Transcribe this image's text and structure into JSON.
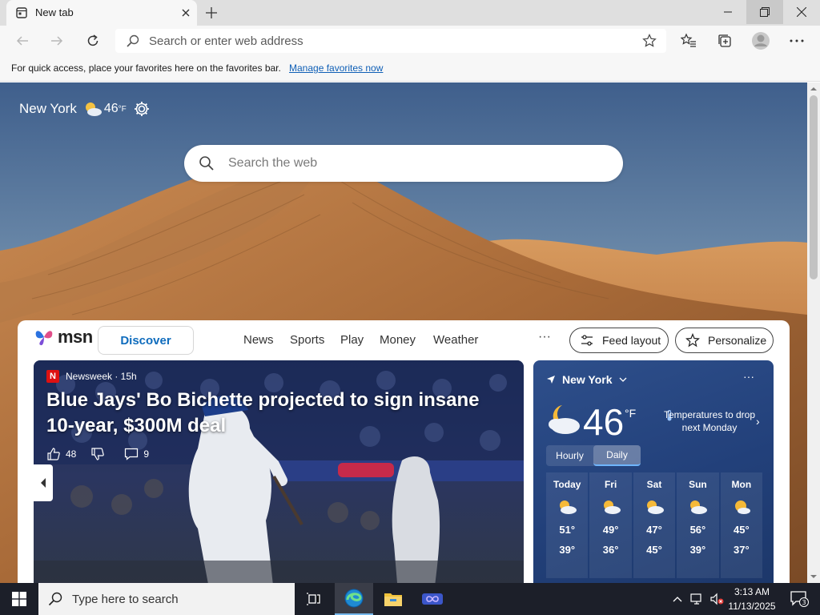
{
  "browser": {
    "tab_title": "New tab",
    "address_placeholder": "Search or enter web address",
    "favbar_text": "For quick access, place your favorites here on the favorites bar.",
    "favbar_link": "Manage favorites now"
  },
  "newtab": {
    "weather_city": "New York",
    "weather_temp": "46",
    "weather_unit": "°F",
    "search_placeholder": "Search the web"
  },
  "feed": {
    "logo": "msn",
    "nav": [
      "Discover",
      "News",
      "Sports",
      "Play",
      "Money",
      "Weather"
    ],
    "more": "···",
    "feed_layout": "Feed layout",
    "personalize": "Personalize"
  },
  "hero": {
    "source_badge": "N",
    "source": "Newsweek · 15h",
    "title": "Blue Jays' Bo Bichette projected to sign insane 10-year, $300M deal",
    "likes": "48",
    "comments": "9"
  },
  "weather_card": {
    "location": "New York",
    "more": "···",
    "temp": "46",
    "unit": "°F",
    "alert": "Temperatures to drop next Monday",
    "tabs": [
      "Hourly",
      "Daily"
    ],
    "active_tab": "Daily",
    "days": [
      {
        "name": "Today",
        "hi": "51°",
        "lo": "39°"
      },
      {
        "name": "Fri",
        "hi": "49°",
        "lo": "36°"
      },
      {
        "name": "Sat",
        "hi": "47°",
        "lo": "45°"
      },
      {
        "name": "Sun",
        "hi": "56°",
        "lo": "39°"
      },
      {
        "name": "Mon",
        "hi": "45°",
        "lo": "37°"
      }
    ]
  },
  "taskbar": {
    "search_placeholder": "Type here to search",
    "time": "3:13 AM",
    "date": "11/13/2025",
    "notification_count": "3"
  },
  "colors": {
    "accent": "#0f6cbd",
    "link": "#0f5fb6",
    "taskbar": "#1c1f29"
  }
}
